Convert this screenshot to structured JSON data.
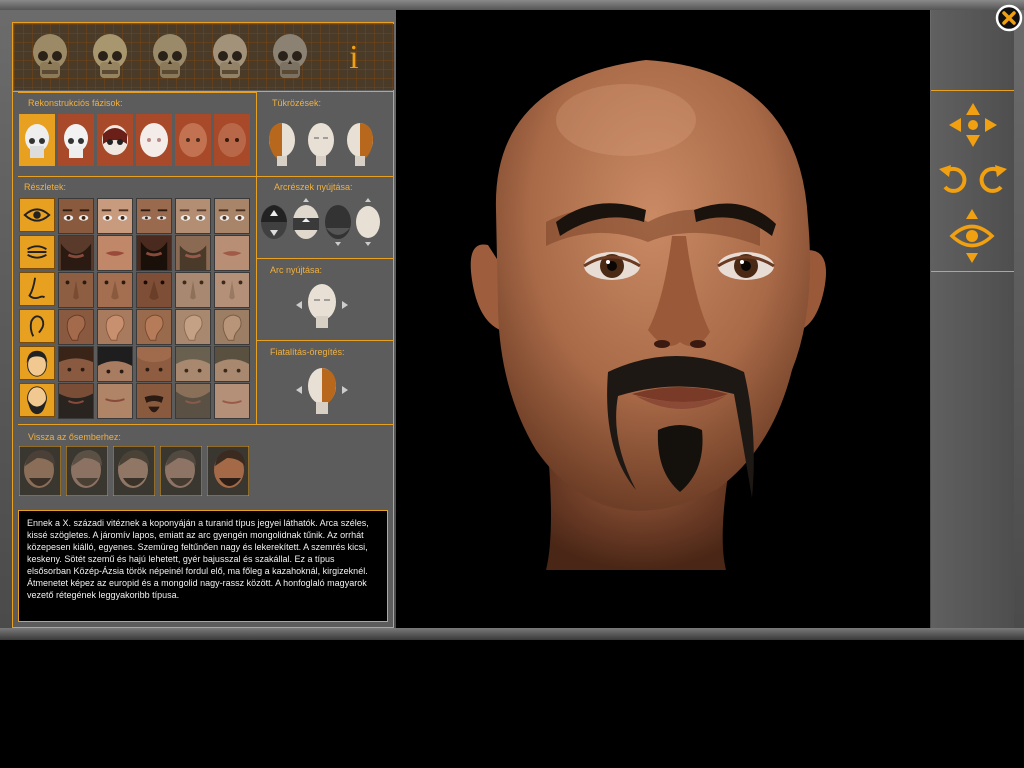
{
  "sections": {
    "reconstruction_phases": "Rekonstrukciós fázisok:",
    "mirroring": "Tükrözések:",
    "details": "Részletek:",
    "face_part_stretch": "Arcrészek nyújtása:",
    "face_stretch": "Arc nyújtása:",
    "rejuvenate_age": "Fiatalítás-öregítés:",
    "back_to_ancestor": "Vissza az ősemberhez:"
  },
  "info_label": "i",
  "description_text": "Ennek a X. századi vitéznek a koponyáján a turanid típus jegyei láthatók. Arca széles, kissé szögletes. A járomív lapos, emiatt az arc gyengén mongolidnak tűnik. Az orrhát közepesen kiálló, egyenes. Szemüreg feltűnően nagy és lekerekített. A szemrés kicsi, keskeny. Sötét szemű és hajú lehetett, gyér bajusszal és szakállal. Ez a típus elsősorban Közép-Ázsia török népeinél fordul elő, ma főleg a kazahoknál, kirgizeknél. Átmenetet képez az europid és a mongolid nagy-rassz között. A honfoglaló magyarok vezető rétegének leggyakoribb típusa.",
  "icons": {
    "close": "close-icon",
    "nav_up": "arrow-up-icon",
    "nav_down": "arrow-down-icon",
    "nav_left": "arrow-left-icon",
    "nav_right": "arrow-right-icon",
    "rotate_left": "rotate-left-icon",
    "rotate_right": "rotate-right-icon",
    "view": "eye-icon"
  },
  "colors": {
    "accent": "#e8a020",
    "panel": "#5c5c5c",
    "viewport": "#000000",
    "skin": "#b8704a"
  }
}
